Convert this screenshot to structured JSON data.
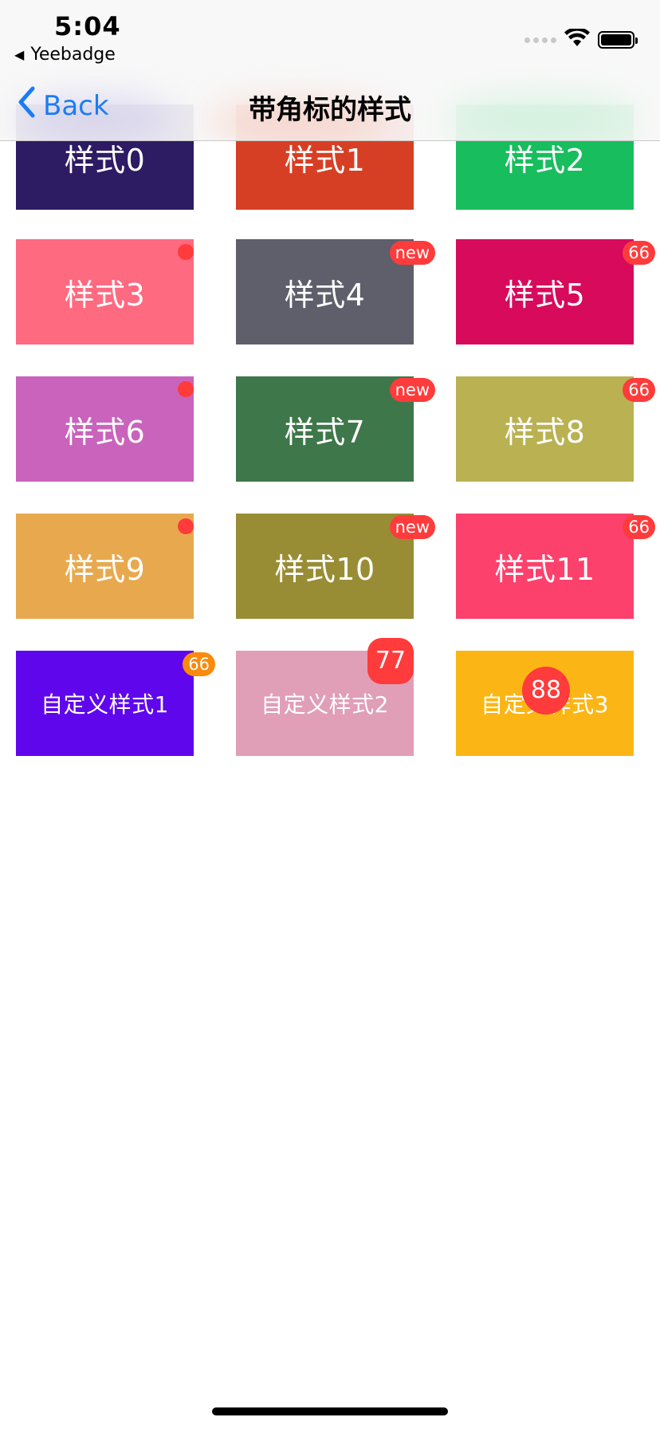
{
  "status_bar": {
    "time": "5:04",
    "back_app": "Yeebadge",
    "icons": [
      "signal-dots-icon",
      "wifi-icon",
      "battery-icon"
    ]
  },
  "nav": {
    "back_label": "Back",
    "title": "带角标的样式"
  },
  "tiles": [
    {
      "label": "样式0",
      "color": "#2d1b63",
      "badge_type": "none",
      "badge_text": ""
    },
    {
      "label": "样式1",
      "color": "#d73f24",
      "badge_type": "none",
      "badge_text": ""
    },
    {
      "label": "样式2",
      "color": "#18bd5e",
      "badge_type": "none",
      "badge_text": ""
    },
    {
      "label": "样式3",
      "color": "#fe6a80",
      "badge_type": "dot",
      "badge_text": ""
    },
    {
      "label": "样式4",
      "color": "#5f5e6b",
      "badge_type": "text",
      "badge_text": "new"
    },
    {
      "label": "样式5",
      "color": "#d70a5c",
      "badge_type": "text",
      "badge_text": "66"
    },
    {
      "label": "样式6",
      "color": "#c963bc",
      "badge_type": "dot",
      "badge_text": ""
    },
    {
      "label": "样式7",
      "color": "#3e774a",
      "badge_type": "text",
      "badge_text": "new"
    },
    {
      "label": "样式8",
      "color": "#bab152",
      "badge_type": "text",
      "badge_text": "66"
    },
    {
      "label": "样式9",
      "color": "#e8a94e",
      "badge_type": "dot",
      "badge_text": ""
    },
    {
      "label": "样式10",
      "color": "#988d34",
      "badge_type": "text",
      "badge_text": "new"
    },
    {
      "label": "样式11",
      "color": "#fc416c",
      "badge_type": "text",
      "badge_text": "66"
    },
    {
      "label": "自定义样式1",
      "color": "#6006ed",
      "badge_type": "text",
      "badge_text": "66",
      "badge_color": "#f98a0c"
    },
    {
      "label": "自定义样式2",
      "color": "#e09fb6",
      "badge_type": "large",
      "badge_text": "77"
    },
    {
      "label": "自定义样式3",
      "color": "#fbb616",
      "badge_type": "circle",
      "badge_text": "88"
    }
  ],
  "colors": {
    "badge_red": "#ff3b3b",
    "nav_tint": "#1a7cf6"
  }
}
